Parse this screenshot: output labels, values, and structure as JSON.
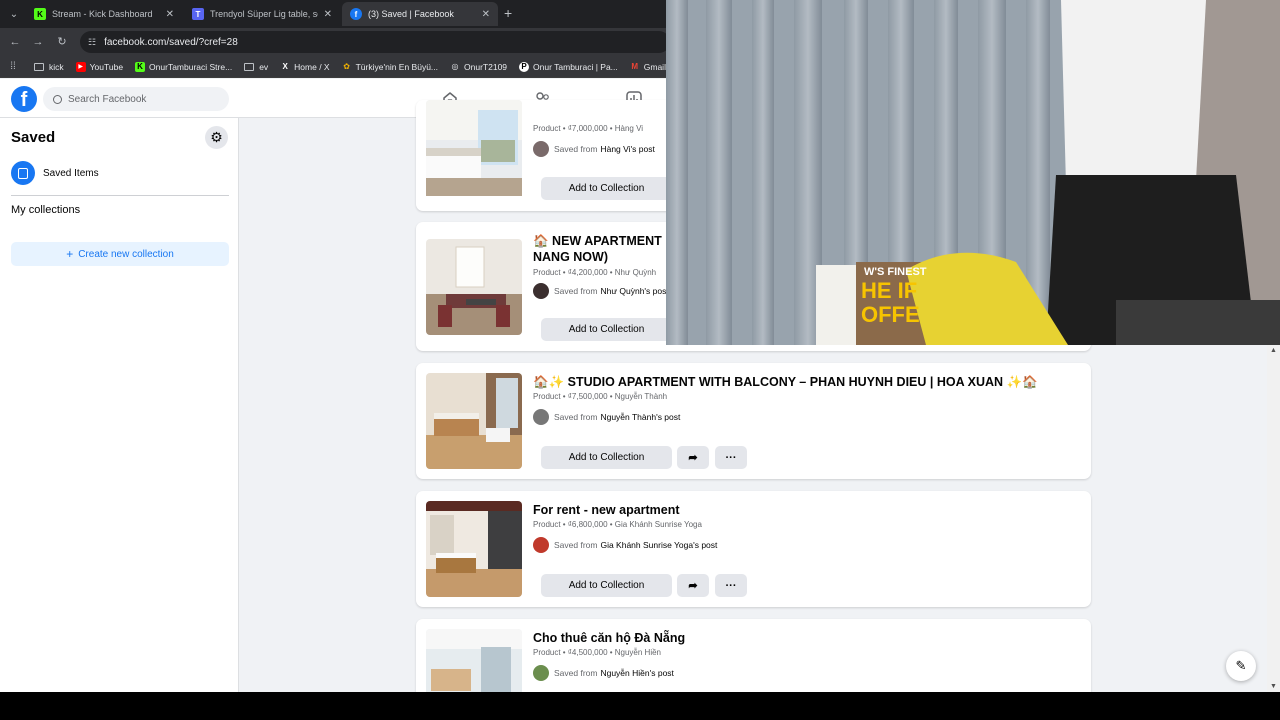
{
  "browser": {
    "tabs": [
      {
        "title": "Stream - Kick Dashboard",
        "favicon_color": "#53fc18",
        "favicon_letter": "K"
      },
      {
        "title": "Trendyol Süper Lig table, scheo",
        "favicon_color": "#5865f2",
        "favicon_letter": "T"
      },
      {
        "title": "(3) Saved | Facebook",
        "favicon_color": "#1877f2",
        "favicon_letter": "f"
      }
    ],
    "address": "facebook.com/saved/?cref=28",
    "bookmarks": [
      "kick",
      "YouTube",
      "OnurTamburaci Stre...",
      "ev",
      "Home / X",
      "Türkiye'nin En Büyü...",
      "OnurT2109",
      "Onur Tamburaci | Pa...",
      "Gmail"
    ]
  },
  "facebook": {
    "search_placeholder": "Search Facebook",
    "brand_color": "#1877f2",
    "nav_icons": [
      "home-icon",
      "friends-icon",
      "dashboard-icon"
    ]
  },
  "sidebar": {
    "title": "Saved",
    "saved_items_label": "Saved Items",
    "my_collections_label": "My collections",
    "create_collection_label": "Create new collection"
  },
  "items": [
    {
      "title": "",
      "meta": "Product • ₫7,000,000 • Hàng Vi",
      "saved_from": "Saved from",
      "source": "Hàng Vi's post",
      "add_label": "Add to Collection"
    },
    {
      "title": "🏠 NEW APARTMENT",
      "title2": "NANG NOW)",
      "meta": "Product • ₫4,200,000 • Như Quỳnh",
      "saved_from": "Saved from",
      "source": "Như Quỳnh's pos",
      "add_label": "Add to Collection"
    },
    {
      "title": "🏠✨ STUDIO APARTMENT WITH BALCONY – PHAN HUYNH DIEU | HOA XUAN ✨🏠",
      "meta": "Product • ₫7,500,000 • Nguyễn Thành",
      "saved_from": "Saved from",
      "source": "Nguyễn Thành's post",
      "add_label": "Add to Collection"
    },
    {
      "title": "For rent - new apartment",
      "meta": "Product • ₫6,800,000 • Gia Khánh Sunrise Yoga",
      "saved_from": "Saved from",
      "source": "Gia Khánh Sunrise Yoga's post",
      "add_label": "Add to Collection"
    },
    {
      "title": "Cho thuê căn hộ Đà Nẵng",
      "meta": "Product • ₫4,500,000 • Nguyễn Hiền",
      "saved_from": "Saved from",
      "source": "Nguyễn Hiền's post",
      "add_label": "Add to Collection"
    }
  ],
  "webcam": {
    "shirt_text_1": "W'S FINEST",
    "shirt_text_2": "HE IF",
    "shirt_text_3": "OFFE"
  }
}
